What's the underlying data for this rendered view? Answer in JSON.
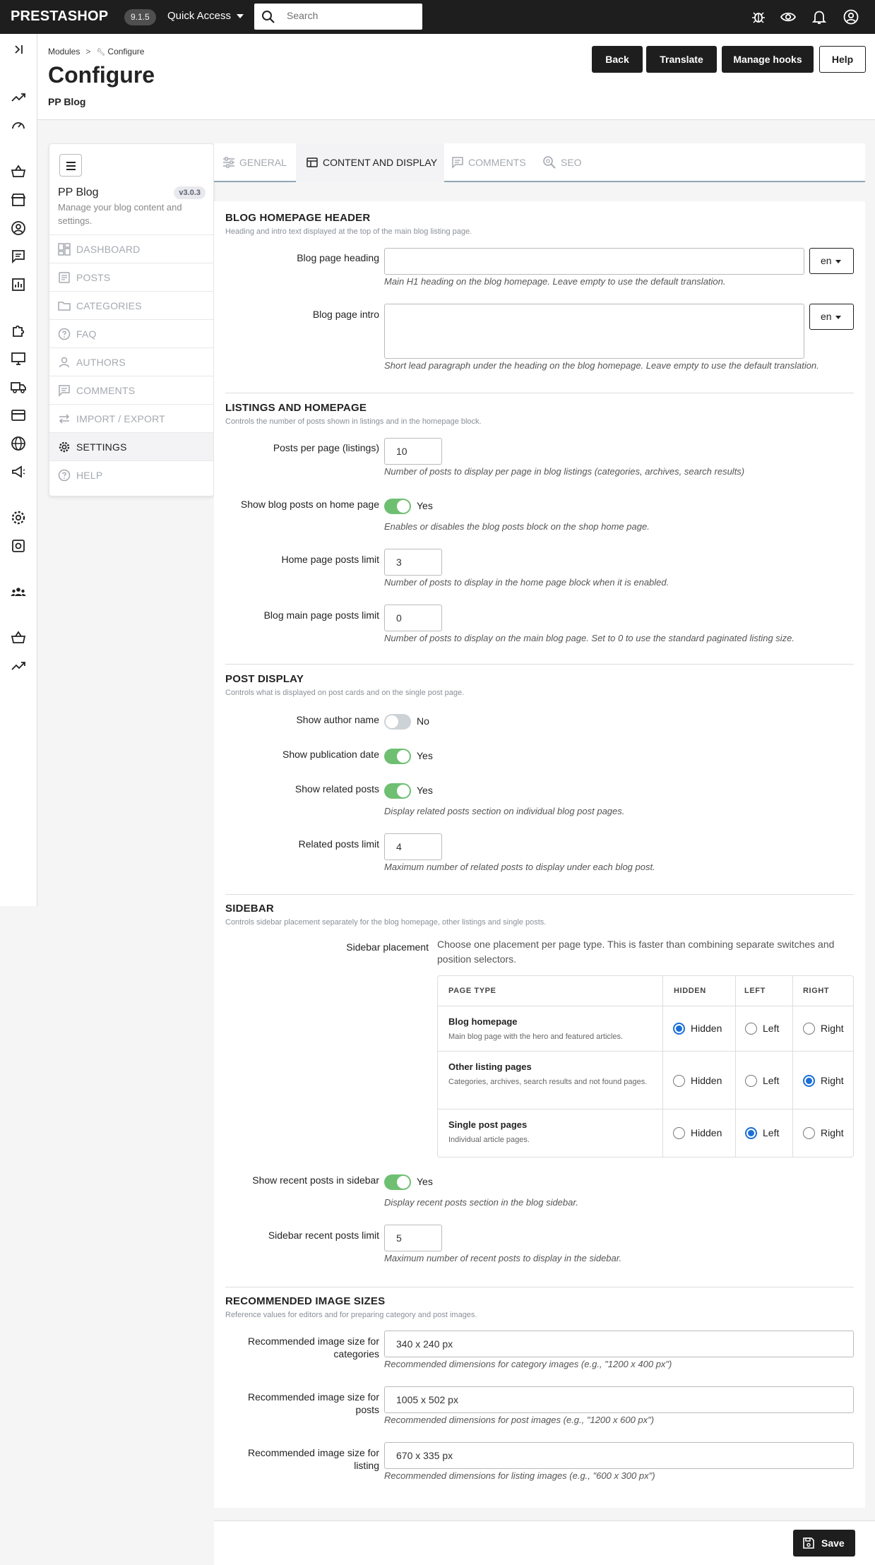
{
  "topbar": {
    "logo": "PRESTASHOP",
    "version": "9.1.5",
    "quick_access": "Quick Access",
    "search_placeholder": "Search"
  },
  "header": {
    "breadcrumb": [
      "Modules",
      "Configure"
    ],
    "title": "Configure",
    "subtitle": "PP Blog",
    "buttons": {
      "back": "Back",
      "translate": "Translate",
      "manage_hooks": "Manage hooks",
      "help": "Help"
    }
  },
  "sidemenu": {
    "title": "PP Blog",
    "version": "v3.0.3",
    "description": "Manage your blog content and settings.",
    "items": [
      {
        "label": "DASHBOARD",
        "icon": "dashboard-icon"
      },
      {
        "label": "POSTS",
        "icon": "posts-icon"
      },
      {
        "label": "CATEGORIES",
        "icon": "folder-icon"
      },
      {
        "label": "FAQ",
        "icon": "question-icon"
      },
      {
        "label": "AUTHORS",
        "icon": "person-icon"
      },
      {
        "label": "COMMENTS",
        "icon": "comment-icon"
      },
      {
        "label": "IMPORT / EXPORT",
        "icon": "swap-icon"
      },
      {
        "label": "SETTINGS",
        "icon": "gear-icon",
        "active": true
      },
      {
        "label": "HELP",
        "icon": "help-icon"
      }
    ]
  },
  "tabs": [
    {
      "label": "GENERAL",
      "icon": "sliders-icon"
    },
    {
      "label": "CONTENT AND DISPLAY",
      "icon": "layout-icon",
      "active": true
    },
    {
      "label": "COMMENTS",
      "icon": "comment-icon"
    },
    {
      "label": "SEO",
      "icon": "seo-search-icon"
    }
  ],
  "sections": {
    "header": {
      "title": "BLOG HOMEPAGE HEADER",
      "subtitle": "Heading and intro text displayed at the top of the main blog listing page.",
      "heading_label": "Blog page heading",
      "heading_value": "",
      "heading_help": "Main H1 heading on the blog homepage. Leave empty to use the default translation.",
      "intro_label": "Blog page intro",
      "intro_value": "",
      "intro_help": "Short lead paragraph under the heading on the blog homepage. Leave empty to use the default translation.",
      "lang": "en"
    },
    "listings": {
      "title": "LISTINGS AND HOMEPAGE",
      "subtitle": "Controls the number of posts shown in listings and in the homepage block.",
      "per_page_label": "Posts per page (listings)",
      "per_page_value": "10",
      "per_page_help": "Number of posts to display per page in blog listings (categories, archives, search results)",
      "show_home_label": "Show blog posts on home page",
      "show_home_state": "Yes",
      "show_home_help": "Enables or disables the blog posts block on the shop home page.",
      "home_limit_label": "Home page posts limit",
      "home_limit_value": "3",
      "home_limit_help": "Number of posts to display in the home page block when it is enabled.",
      "main_limit_label": "Blog main page posts limit",
      "main_limit_value": "0",
      "main_limit_help": "Number of posts to display on the main blog page. Set to 0 to use the standard paginated listing size."
    },
    "post_display": {
      "title": "POST DISPLAY",
      "subtitle": "Controls what is displayed on post cards and on the single post page.",
      "author_label": "Show author name",
      "author_state": "No",
      "date_label": "Show publication date",
      "date_state": "Yes",
      "related_label": "Show related posts",
      "related_state": "Yes",
      "related_help": "Display related posts section on individual blog post pages.",
      "related_limit_label": "Related posts limit",
      "related_limit_value": "4",
      "related_limit_help": "Maximum number of related posts to display under each blog post."
    },
    "sidebar": {
      "title": "SIDEBAR",
      "subtitle": "Controls sidebar placement separately for the blog homepage, other listings and single posts.",
      "placement_label": "Sidebar placement",
      "placement_desc": "Choose one placement per page type. This is faster than combining separate switches and position selectors.",
      "table_headers": [
        "PAGE TYPE",
        "HIDDEN",
        "LEFT",
        "RIGHT"
      ],
      "option_labels": [
        "Hidden",
        "Left",
        "Right"
      ],
      "rows": [
        {
          "name": "Blog homepage",
          "desc": "Main blog page with the hero and featured articles.",
          "selected": "Hidden"
        },
        {
          "name": "Other listing pages",
          "desc": "Categories, archives, search results and not found pages.",
          "selected": "Right"
        },
        {
          "name": "Single post pages",
          "desc": "Individual article pages.",
          "selected": "Left"
        }
      ],
      "recent_label": "Show recent posts in sidebar",
      "recent_state": "Yes",
      "recent_help": "Display recent posts section in the blog sidebar.",
      "recent_limit_label": "Sidebar recent posts limit",
      "recent_limit_value": "5",
      "recent_limit_help": "Maximum number of recent posts to display in the sidebar."
    },
    "images": {
      "title": "RECOMMENDED IMAGE SIZES",
      "subtitle": "Reference values for editors and for preparing category and post images.",
      "categories_label": "Recommended image size for categories",
      "categories_value": "340 x 240 px",
      "categories_help": "Recommended dimensions for category images (e.g., \"1200 x 400 px\")",
      "posts_label": "Recommended image size for posts",
      "posts_value": "1005 x 502 px",
      "posts_help": "Recommended dimensions for post images (e.g., \"1200 x 600 px\")",
      "listing_label": "Recommended image size for listing",
      "listing_value": "670 x 335 px",
      "listing_help": "Recommended dimensions for listing images (e.g., \"600 x 300 px\")"
    }
  },
  "footer": {
    "save": "Save"
  },
  "colors": {
    "toggle_on": "#6fbf73",
    "radio": "#1a6fd8",
    "dark": "#1e1e1e"
  }
}
